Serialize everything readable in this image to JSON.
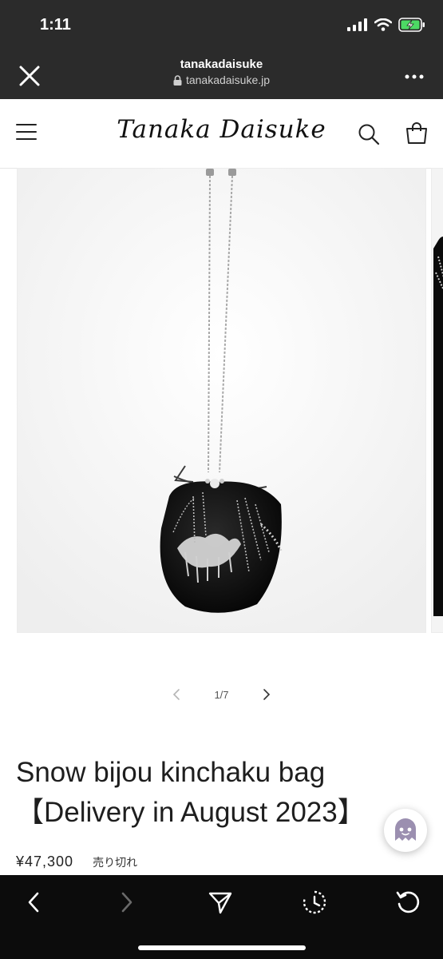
{
  "status_bar": {
    "time": "1:11"
  },
  "browser": {
    "site_name": "tanakadaisuke",
    "url": "tanakadaisuke.jp"
  },
  "site": {
    "logo_text": "Tanaka Daisuke"
  },
  "gallery": {
    "counter": "1/7"
  },
  "product": {
    "title": "Snow bijou kinchaku bag 【Delivery in August 2023】",
    "price": "¥47,300",
    "availability": "売り切れ"
  },
  "colors": {
    "browser_chrome": "#2b2b2b",
    "bottom_toolbar": "#0c0c0c",
    "battery_charging": "#4cd964",
    "chat_avatar": "#9b8fb0"
  },
  "icons": {
    "close": "close-icon",
    "more": "more-icon",
    "menu": "hamburger-icon",
    "search": "search-icon",
    "cart": "bag-icon",
    "prev": "chevron-left-icon",
    "next": "chevron-right-icon",
    "share": "share-icon",
    "history": "history-icon",
    "reload": "reload-icon"
  }
}
